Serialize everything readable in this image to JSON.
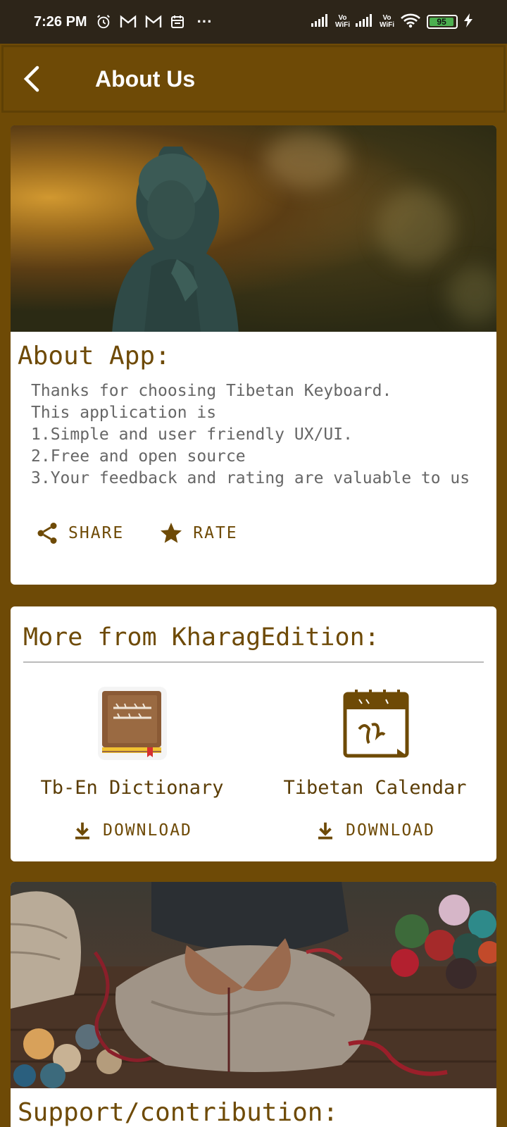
{
  "status_bar": {
    "time": "7:26 PM",
    "more": "···",
    "network_label_1": "Vo\nWiFi",
    "network_label_2": "Vo\nWiFi",
    "battery": "95",
    "battery_level": 0.95
  },
  "toolbar": {
    "title": "About Us"
  },
  "about": {
    "heading": "About App:",
    "text": "Thanks for choosing Tibetan Keyboard.\nThis application is\n1.Simple and user friendly UX/UI.\n2.Free and open source\n3.Your feedback and rating are valuable to us",
    "share_label": "SHARE",
    "rate_label": "RATE"
  },
  "more": {
    "heading": "More from KharagEdition:",
    "apps": [
      {
        "name": "Tb-En Dictionary",
        "download_label": "DOWNLOAD",
        "icon": "dictionary-book-icon"
      },
      {
        "name": "Tibetan Calendar",
        "download_label": "DOWNLOAD",
        "icon": "calendar-icon"
      }
    ]
  },
  "support": {
    "heading": "Support/contribution:"
  },
  "colors": {
    "primary": "#6e4a06",
    "status_bar": "#2d2519",
    "card": "#ffffff"
  }
}
